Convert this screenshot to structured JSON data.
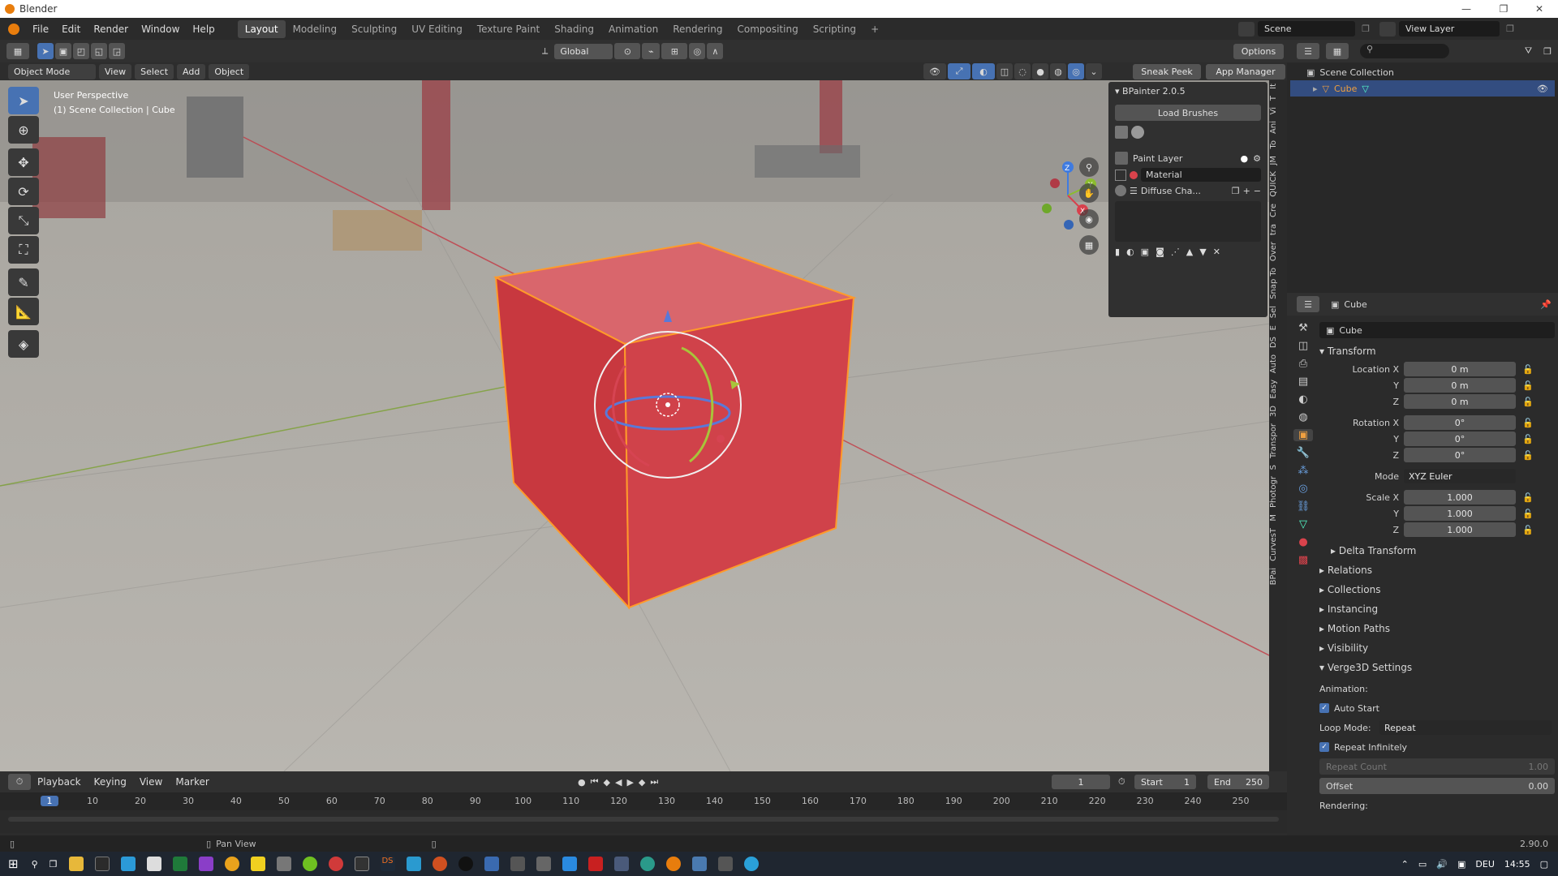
{
  "window": {
    "title": "Blender"
  },
  "menu": {
    "items": [
      "File",
      "Edit",
      "Render",
      "Window",
      "Help"
    ]
  },
  "workspaces": [
    "Layout",
    "Modeling",
    "Sculpting",
    "UV Editing",
    "Texture Paint",
    "Shading",
    "Animation",
    "Rendering",
    "Compositing",
    "Scripting"
  ],
  "top_right": {
    "scene": "Scene",
    "view_layer": "View Layer"
  },
  "header3d": {
    "transform": "Global",
    "options": "Options"
  },
  "header2": {
    "mode": "Object Mode",
    "view": "View",
    "select": "Select",
    "add": "Add",
    "object": "Object",
    "sneak_peek": "Sneak Peek",
    "app_manager": "App Manager"
  },
  "viewport": {
    "perspective": "User Perspective",
    "collection": "(1) Scene Collection | Cube"
  },
  "gizmo_axes": {
    "x": "X",
    "y": "Y",
    "z": "Z"
  },
  "bpainter": {
    "title": "BPainter 2.0.5",
    "load_brushes": "Load Brushes",
    "paint_layer": "Paint Layer",
    "material": "Material",
    "diffuse": "Diffuse Cha..."
  },
  "side_tabs": [
    "It",
    "T",
    "Vi",
    "Ani",
    "To",
    "JM",
    "QUICK",
    "Cre",
    "tra",
    "Over",
    "Snap To",
    "Sel",
    "E",
    "DS",
    "Auto",
    "Easy",
    "3D",
    "Transpor",
    "S",
    "Photogr",
    "M",
    "CurvesT",
    "BPai"
  ],
  "outliner": {
    "root": "Scene Collection",
    "item": "Cube"
  },
  "properties": {
    "object_name": "Cube",
    "object_field": "Cube",
    "transform_title": "Transform",
    "location": {
      "label": "Location X",
      "x": "0 m",
      "y": "0 m",
      "z": "0 m"
    },
    "rotation": {
      "label": "Rotation X",
      "x": "0°",
      "y": "0°",
      "z": "0°"
    },
    "mode_label": "Mode",
    "mode": "XYZ Euler",
    "scale": {
      "label": "Scale X",
      "x": "1.000",
      "y": "1.000",
      "z": "1.000"
    },
    "axis_y": "Y",
    "axis_z": "Z",
    "delta": "Delta Transform",
    "sections": [
      "Relations",
      "Collections",
      "Instancing",
      "Motion Paths",
      "Visibility"
    ],
    "verge": "Verge3D Settings",
    "animation_label": "Animation:",
    "auto_start": "Auto Start",
    "loop_label": "Loop Mode:",
    "loop": "Repeat",
    "repeat_inf": "Repeat Infinitely",
    "repeat_count_label": "Repeat Count",
    "repeat_count": "1.00",
    "offset_label": "Offset",
    "offset": "0.00",
    "rendering_label": "Rendering:"
  },
  "timeline": {
    "playback": "Playback",
    "keying": "Keying",
    "view": "View",
    "marker": "Marker",
    "current": "1",
    "start_label": "Start",
    "start": "1",
    "end_label": "End",
    "end": "250",
    "ticks": [
      "1",
      "10",
      "20",
      "30",
      "40",
      "50",
      "60",
      "70",
      "80",
      "90",
      "100",
      "110",
      "120",
      "130",
      "140",
      "150",
      "160",
      "170",
      "180",
      "190",
      "200",
      "210",
      "220",
      "230",
      "240",
      "250"
    ]
  },
  "status": {
    "hint": "Pan View",
    "version": "2.90.0"
  },
  "taskbar": {
    "lang": "DEU",
    "time": "14:55"
  },
  "colors": {
    "accent": "#4772b3",
    "cube": "#d2444a",
    "select_outline": "#ff9a2a",
    "brand": "#e87d0d"
  }
}
